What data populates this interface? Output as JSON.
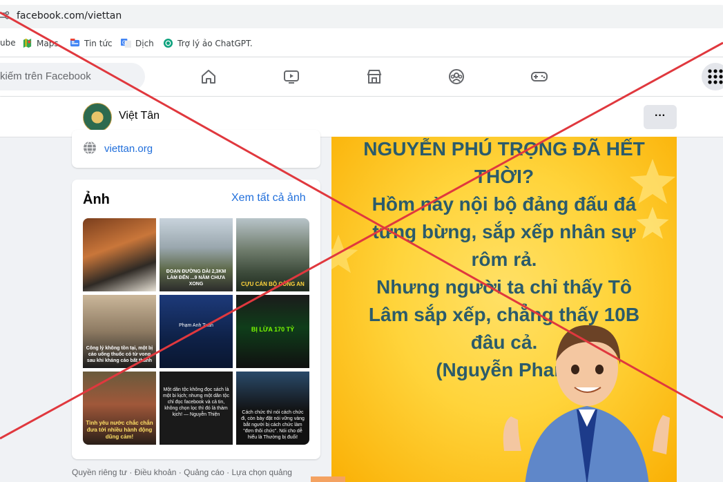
{
  "browser": {
    "url": "facebook.com/viettan",
    "bookmarks": [
      {
        "label": "ube",
        "icon": "youtube-icon"
      },
      {
        "label": "Maps",
        "icon": "maps-icon"
      },
      {
        "label": "Tin tức",
        "icon": "news-icon"
      },
      {
        "label": "Dịch",
        "icon": "translate-icon"
      },
      {
        "label": "Trợ lý ảo ChatGPT.",
        "icon": "chatgpt-icon"
      }
    ]
  },
  "fb": {
    "search_placeholder": "kiếm trên Facebook",
    "nav_icons": [
      "home-icon",
      "video-icon",
      "marketplace-icon",
      "groups-icon",
      "gaming-icon",
      "apps-menu-icon"
    ]
  },
  "page": {
    "name": "Việt Tân",
    "more_label": "···",
    "website": "viettan.org"
  },
  "photos": {
    "title": "Ảnh",
    "see_all": "Xem tất cả ảnh",
    "tiles": [
      {
        "caption": ""
      },
      {
        "caption": "ĐOẠN ĐƯỜNG DÀI 2,3KM LÀM ĐẾN ...9 NĂM CHƯA XONG"
      },
      {
        "caption": "CỰU CÁN BỘ CÔNG AN"
      },
      {
        "caption": "Công lý không tồn tại, một bị cáo uống thuốc có từ vong sau khi kháng cáo bất thành"
      },
      {
        "caption": "Phạm Anh Tuấn"
      },
      {
        "caption": "BỊ LỪA 170 TỶ"
      },
      {
        "caption": "Tình yêu nước chắc chắn đưa tới nhiều hành động dũng cảm!"
      },
      {
        "caption": "Một dân tộc không đọc sách là một bi kịch; nhưng một dân tộc chỉ đọc facebook và cả tin, không chọn lọc thì đó là thảm kịch! — Nguyễn Thiện"
      },
      {
        "caption": "Cách chức thì nói cách chức đi, còn bày đặt nói vững vàng bắt người bị cách chức làm \"đơn thôi chức\". Nói cho dễ hiểu là Thường bị đuổi!"
      }
    ]
  },
  "footer": "Quyền riêng tư · Điều khoản · Quảng cáo · Lựa chọn quảng",
  "post": {
    "lines": [
      "NGUYỄN PHÚ TRỌNG ĐÃ HẾT",
      "THỜI?",
      "Hồm này nội bộ đảng đấu đá",
      "tưng bừng, sắp xếp nhân sự",
      "rôm rả.",
      "Nhưng người ta chỉ thấy Tô",
      "Lâm sắp xếp, chẳng thấy 10B",
      "đâu cả.",
      "(Nguyễn Phan)"
    ]
  },
  "colors": {
    "link": "#216fdb",
    "overlay_x": "#e0383e",
    "post_text": "#2b5b6b",
    "post_bg": "#ffd43b"
  }
}
